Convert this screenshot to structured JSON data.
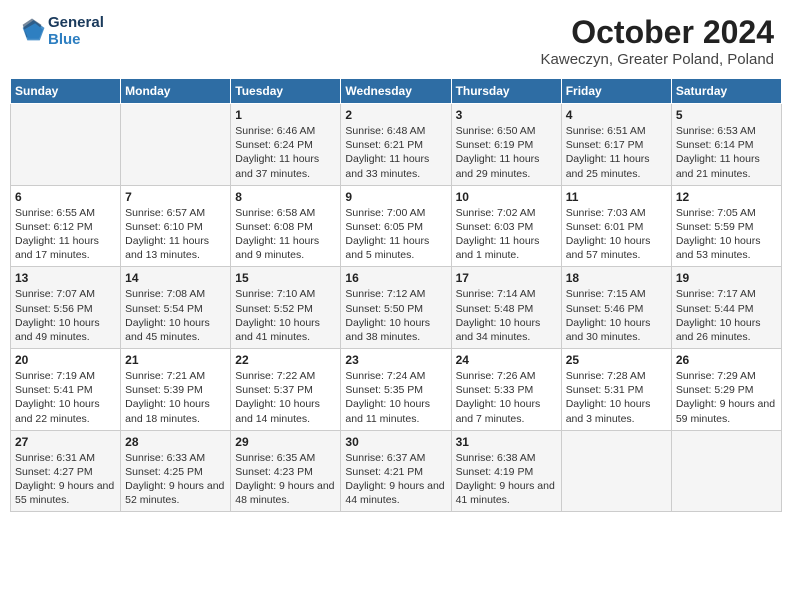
{
  "header": {
    "logo_line1": "General",
    "logo_line2": "Blue",
    "title": "October 2024",
    "subtitle": "Kaweczyn, Greater Poland, Poland"
  },
  "weekdays": [
    "Sunday",
    "Monday",
    "Tuesday",
    "Wednesday",
    "Thursday",
    "Friday",
    "Saturday"
  ],
  "weeks": [
    [
      {
        "day": null
      },
      {
        "day": null
      },
      {
        "day": "1",
        "sunrise": "Sunrise: 6:46 AM",
        "sunset": "Sunset: 6:24 PM",
        "daylight": "Daylight: 11 hours and 37 minutes."
      },
      {
        "day": "2",
        "sunrise": "Sunrise: 6:48 AM",
        "sunset": "Sunset: 6:21 PM",
        "daylight": "Daylight: 11 hours and 33 minutes."
      },
      {
        "day": "3",
        "sunrise": "Sunrise: 6:50 AM",
        "sunset": "Sunset: 6:19 PM",
        "daylight": "Daylight: 11 hours and 29 minutes."
      },
      {
        "day": "4",
        "sunrise": "Sunrise: 6:51 AM",
        "sunset": "Sunset: 6:17 PM",
        "daylight": "Daylight: 11 hours and 25 minutes."
      },
      {
        "day": "5",
        "sunrise": "Sunrise: 6:53 AM",
        "sunset": "Sunset: 6:14 PM",
        "daylight": "Daylight: 11 hours and 21 minutes."
      }
    ],
    [
      {
        "day": "6",
        "sunrise": "Sunrise: 6:55 AM",
        "sunset": "Sunset: 6:12 PM",
        "daylight": "Daylight: 11 hours and 17 minutes."
      },
      {
        "day": "7",
        "sunrise": "Sunrise: 6:57 AM",
        "sunset": "Sunset: 6:10 PM",
        "daylight": "Daylight: 11 hours and 13 minutes."
      },
      {
        "day": "8",
        "sunrise": "Sunrise: 6:58 AM",
        "sunset": "Sunset: 6:08 PM",
        "daylight": "Daylight: 11 hours and 9 minutes."
      },
      {
        "day": "9",
        "sunrise": "Sunrise: 7:00 AM",
        "sunset": "Sunset: 6:05 PM",
        "daylight": "Daylight: 11 hours and 5 minutes."
      },
      {
        "day": "10",
        "sunrise": "Sunrise: 7:02 AM",
        "sunset": "Sunset: 6:03 PM",
        "daylight": "Daylight: 11 hours and 1 minute."
      },
      {
        "day": "11",
        "sunrise": "Sunrise: 7:03 AM",
        "sunset": "Sunset: 6:01 PM",
        "daylight": "Daylight: 10 hours and 57 minutes."
      },
      {
        "day": "12",
        "sunrise": "Sunrise: 7:05 AM",
        "sunset": "Sunset: 5:59 PM",
        "daylight": "Daylight: 10 hours and 53 minutes."
      }
    ],
    [
      {
        "day": "13",
        "sunrise": "Sunrise: 7:07 AM",
        "sunset": "Sunset: 5:56 PM",
        "daylight": "Daylight: 10 hours and 49 minutes."
      },
      {
        "day": "14",
        "sunrise": "Sunrise: 7:08 AM",
        "sunset": "Sunset: 5:54 PM",
        "daylight": "Daylight: 10 hours and 45 minutes."
      },
      {
        "day": "15",
        "sunrise": "Sunrise: 7:10 AM",
        "sunset": "Sunset: 5:52 PM",
        "daylight": "Daylight: 10 hours and 41 minutes."
      },
      {
        "day": "16",
        "sunrise": "Sunrise: 7:12 AM",
        "sunset": "Sunset: 5:50 PM",
        "daylight": "Daylight: 10 hours and 38 minutes."
      },
      {
        "day": "17",
        "sunrise": "Sunrise: 7:14 AM",
        "sunset": "Sunset: 5:48 PM",
        "daylight": "Daylight: 10 hours and 34 minutes."
      },
      {
        "day": "18",
        "sunrise": "Sunrise: 7:15 AM",
        "sunset": "Sunset: 5:46 PM",
        "daylight": "Daylight: 10 hours and 30 minutes."
      },
      {
        "day": "19",
        "sunrise": "Sunrise: 7:17 AM",
        "sunset": "Sunset: 5:44 PM",
        "daylight": "Daylight: 10 hours and 26 minutes."
      }
    ],
    [
      {
        "day": "20",
        "sunrise": "Sunrise: 7:19 AM",
        "sunset": "Sunset: 5:41 PM",
        "daylight": "Daylight: 10 hours and 22 minutes."
      },
      {
        "day": "21",
        "sunrise": "Sunrise: 7:21 AM",
        "sunset": "Sunset: 5:39 PM",
        "daylight": "Daylight: 10 hours and 18 minutes."
      },
      {
        "day": "22",
        "sunrise": "Sunrise: 7:22 AM",
        "sunset": "Sunset: 5:37 PM",
        "daylight": "Daylight: 10 hours and 14 minutes."
      },
      {
        "day": "23",
        "sunrise": "Sunrise: 7:24 AM",
        "sunset": "Sunset: 5:35 PM",
        "daylight": "Daylight: 10 hours and 11 minutes."
      },
      {
        "day": "24",
        "sunrise": "Sunrise: 7:26 AM",
        "sunset": "Sunset: 5:33 PM",
        "daylight": "Daylight: 10 hours and 7 minutes."
      },
      {
        "day": "25",
        "sunrise": "Sunrise: 7:28 AM",
        "sunset": "Sunset: 5:31 PM",
        "daylight": "Daylight: 10 hours and 3 minutes."
      },
      {
        "day": "26",
        "sunrise": "Sunrise: 7:29 AM",
        "sunset": "Sunset: 5:29 PM",
        "daylight": "Daylight: 9 hours and 59 minutes."
      }
    ],
    [
      {
        "day": "27",
        "sunrise": "Sunrise: 6:31 AM",
        "sunset": "Sunset: 4:27 PM",
        "daylight": "Daylight: 9 hours and 55 minutes."
      },
      {
        "day": "28",
        "sunrise": "Sunrise: 6:33 AM",
        "sunset": "Sunset: 4:25 PM",
        "daylight": "Daylight: 9 hours and 52 minutes."
      },
      {
        "day": "29",
        "sunrise": "Sunrise: 6:35 AM",
        "sunset": "Sunset: 4:23 PM",
        "daylight": "Daylight: 9 hours and 48 minutes."
      },
      {
        "day": "30",
        "sunrise": "Sunrise: 6:37 AM",
        "sunset": "Sunset: 4:21 PM",
        "daylight": "Daylight: 9 hours and 44 minutes."
      },
      {
        "day": "31",
        "sunrise": "Sunrise: 6:38 AM",
        "sunset": "Sunset: 4:19 PM",
        "daylight": "Daylight: 9 hours and 41 minutes."
      },
      {
        "day": null
      },
      {
        "day": null
      }
    ]
  ]
}
